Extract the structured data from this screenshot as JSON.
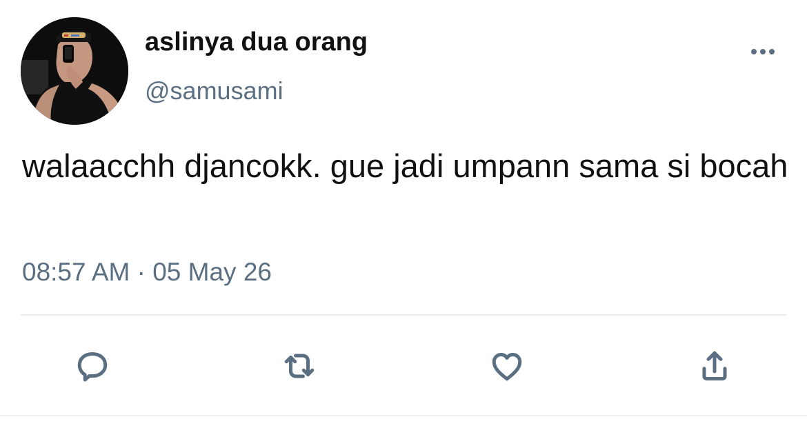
{
  "tweet": {
    "display_name": "aslinya dua orang",
    "handle": "@samusami",
    "text": "walaacchh djancokk. gue jadi umpann sama si bocah",
    "timestamp": "08:57 AM · 05 May 26"
  },
  "icons": {
    "more": "more-horizontal-icon",
    "reply": "reply-icon",
    "retweet": "retweet-icon",
    "like": "heart-icon",
    "share": "share-icon"
  },
  "colors": {
    "primary_text": "#111111",
    "secondary_text": "#5b6f82",
    "divider": "#e6ecf0",
    "background": "#ffffff"
  }
}
